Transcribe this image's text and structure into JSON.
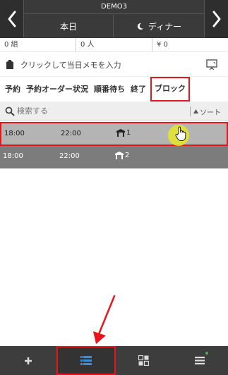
{
  "header": {
    "store_name": "DEMO3",
    "date_label": "本日",
    "session_label": "ディナー",
    "prev_icon": "chevron-left-icon",
    "next_icon": "chevron-right-icon",
    "session_icon": "moon-icon"
  },
  "stats": {
    "groups": "0 組",
    "people": "0 人",
    "amount": "¥ 0"
  },
  "memo": {
    "text": "クリックして当日メモを入力"
  },
  "tabs": [
    {
      "label": "予約"
    },
    {
      "label": "予約オーダー状況"
    },
    {
      "label": "順番待ち"
    },
    {
      "label": "終了"
    },
    {
      "label": "ブロック"
    }
  ],
  "search": {
    "placeholder": "検索する",
    "sort_label": "ソート"
  },
  "rows": [
    {
      "start": "18:00",
      "end": "22:00",
      "table": "1"
    },
    {
      "start": "18:00",
      "end": "22:00",
      "table": "2"
    }
  ],
  "bottom_nav": [
    {
      "icon": "plus-icon"
    },
    {
      "icon": "list-icon"
    },
    {
      "icon": "grid-icon"
    },
    {
      "icon": "menu-icon"
    }
  ],
  "colors": {
    "topbar": "#3a3a3a",
    "highlight": "#e5161c",
    "row_selected": "#b4b4b4",
    "row": "#7c7c7c",
    "list_icon": "#3b8fd6"
  }
}
